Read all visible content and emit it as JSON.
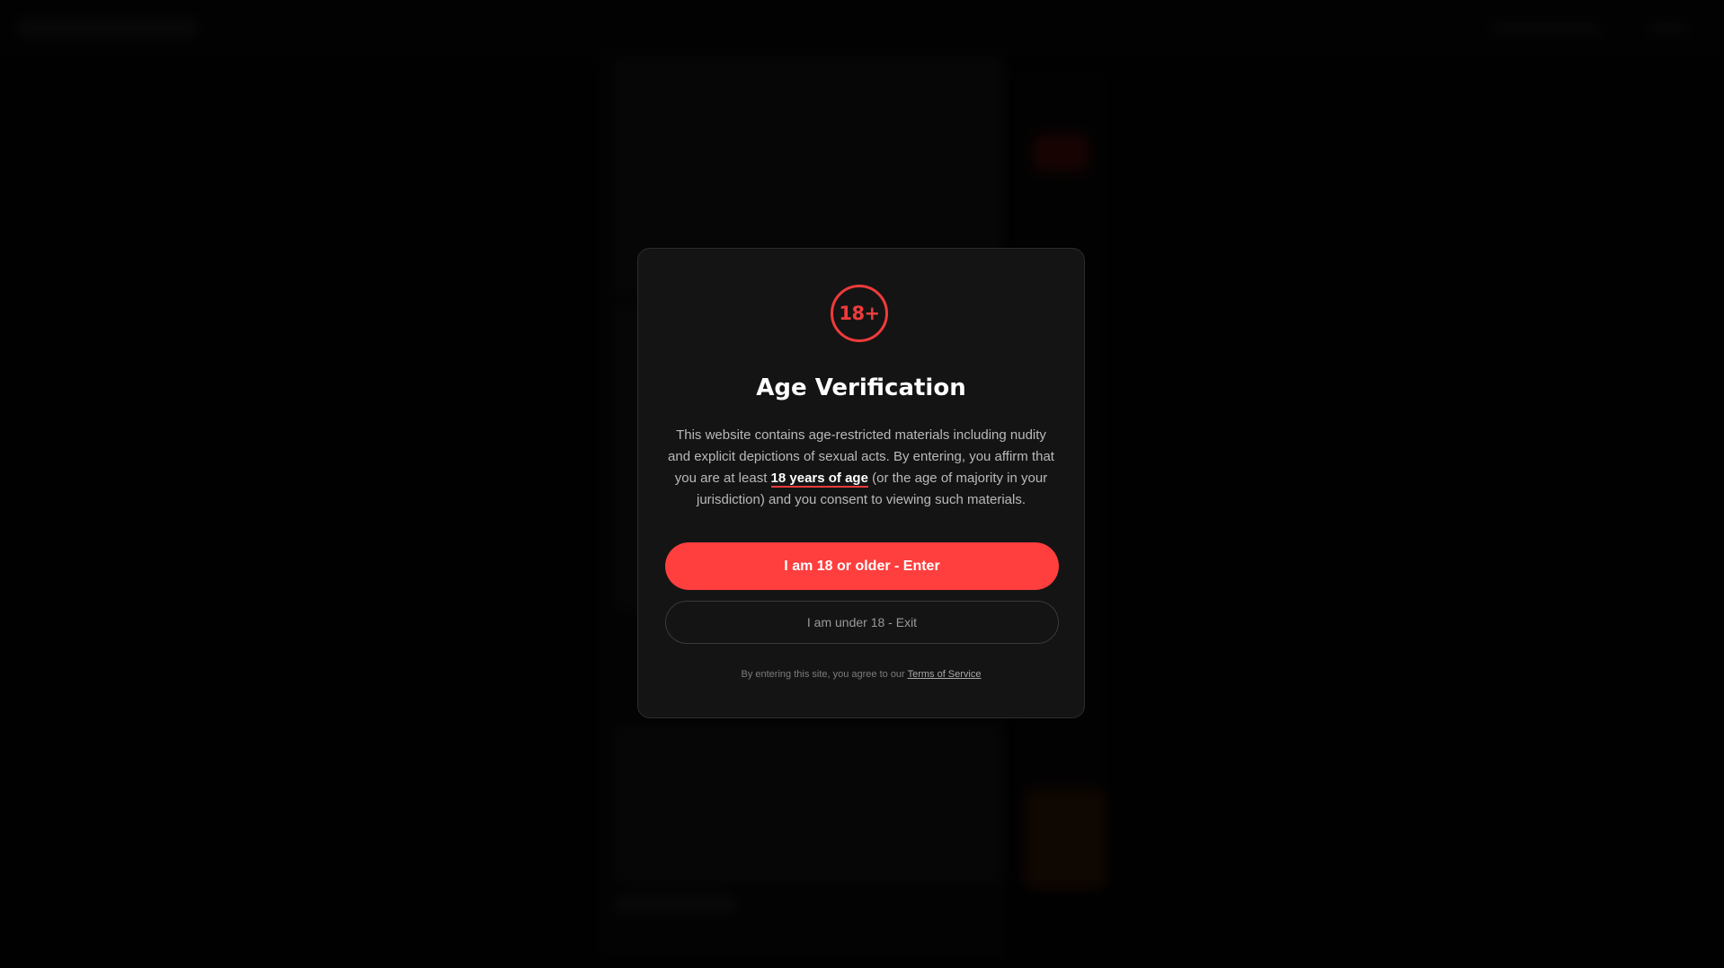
{
  "modal": {
    "badge_text": "18+",
    "title": "Age Verification",
    "description_part1": "This website contains age-restricted materials including nudity and explicit depictions of sexual acts. By entering, you affirm that you are at least ",
    "description_emphasis": "18 years of age",
    "description_part2": " (or the age of majority in your jurisdiction) and you consent to viewing such materials.",
    "enter_button": "I am 18 or older - Enter",
    "exit_button": "I am under 18 - Exit",
    "footer_text": "By entering this site, you agree to our ",
    "footer_link": "Terms of Service"
  },
  "colors": {
    "accent": "#ff3e3e",
    "modal_background": "#141414",
    "page_background": "#030303"
  },
  "icons": {
    "age_badge": "18-plus-badge-icon"
  }
}
